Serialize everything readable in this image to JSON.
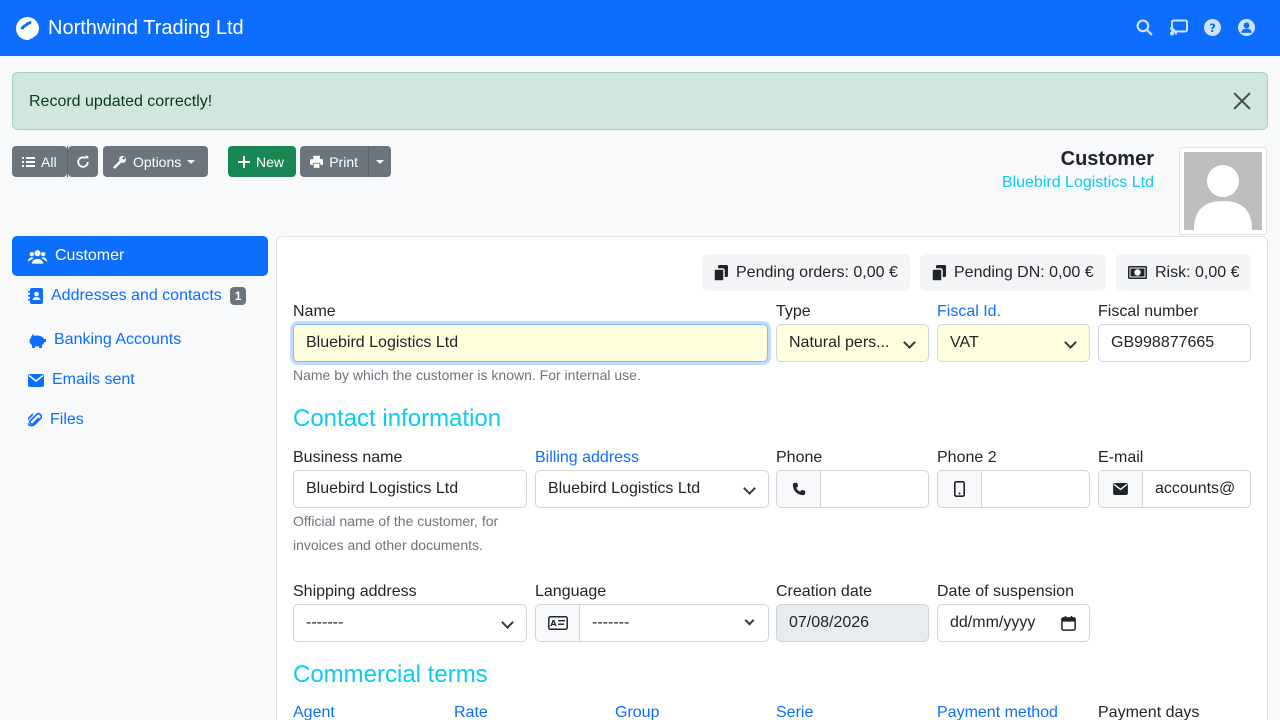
{
  "navbar": {
    "brand": "Northwind Trading Ltd"
  },
  "alert": {
    "message": "Record updated correctly!"
  },
  "toolbar": {
    "all_label": "All",
    "options_label": "Options",
    "new_label": "New",
    "print_label": "Print"
  },
  "header": {
    "title": "Customer",
    "subtitle": "Bluebird Logistics Ltd"
  },
  "sidebar": {
    "items": [
      {
        "label": "Customer"
      },
      {
        "label": "Addresses and contacts",
        "badge": "1"
      },
      {
        "label": "Banking Accounts"
      },
      {
        "label": "Emails sent"
      },
      {
        "label": "Files"
      }
    ]
  },
  "stats": {
    "pending_orders": "Pending orders: 0,00 €",
    "pending_dn": "Pending DN: 0,00 €",
    "risk": "Risk: 0,00 €"
  },
  "form": {
    "name_label": "Name",
    "name_value": "Bluebird Logistics Ltd",
    "name_help": "Name by which the customer is known. For internal use.",
    "type_label": "Type",
    "type_value": "Natural pers...",
    "fiscal_id_label": "Fiscal Id.",
    "fiscal_id_value": "VAT",
    "fiscal_number_label": "Fiscal number",
    "fiscal_number_value": "GB998877665",
    "contact_section": "Contact information",
    "business_name_label": "Business name",
    "business_name_value": "Bluebird Logistics Ltd",
    "business_help_1": "Official name of the customer, for",
    "business_help_2": "invoices and other documents.",
    "billing_label": "Billing address",
    "billing_value": "Bluebird Logistics Ltd",
    "phone_label": "Phone",
    "phone_value": "",
    "phone2_label": "Phone 2",
    "phone2_value": "",
    "email_label": "E-mail",
    "email_value": "accounts@",
    "shipping_label": "Shipping address",
    "shipping_value": "-------",
    "language_label": "Language",
    "language_value": "-------",
    "creation_label": "Creation date",
    "creation_value": "07/08/2026",
    "suspension_label": "Date of suspension",
    "suspension_value": "dd/mm/yyyy",
    "commercial_section": "Commercial terms",
    "agent_label": "Agent",
    "rate_label": "Rate",
    "group_label": "Group",
    "serie_label": "Serie",
    "payment_method_label": "Payment method",
    "payment_days_label": "Payment days"
  }
}
